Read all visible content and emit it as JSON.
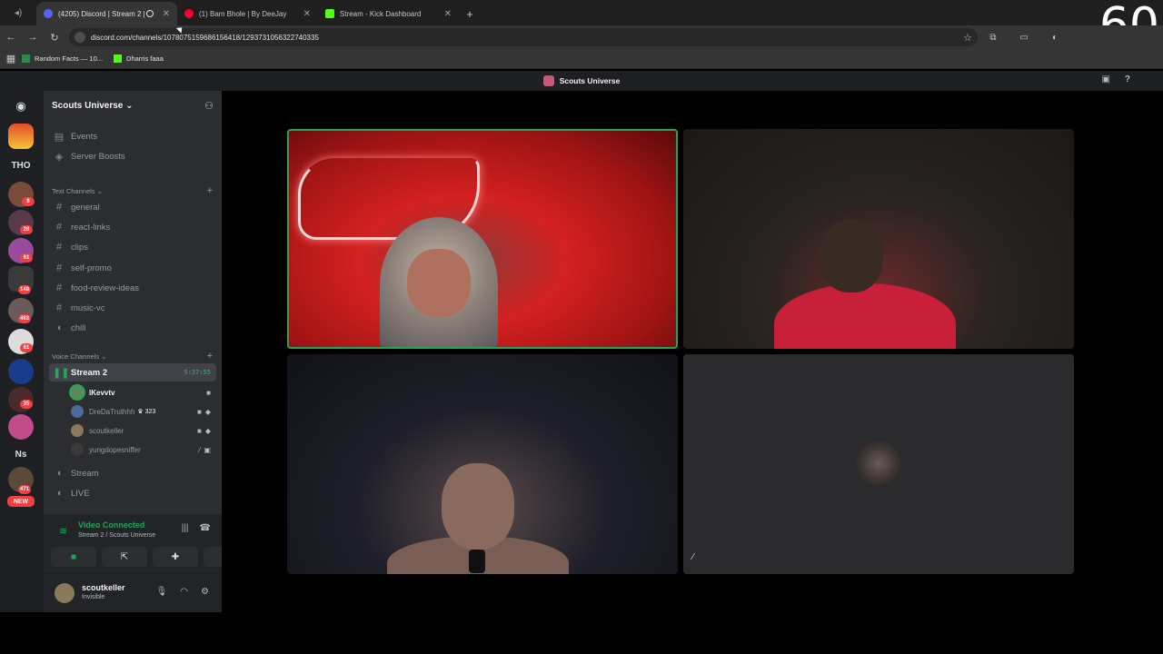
{
  "browser": {
    "tabs": [
      {
        "label": "(4205) Discord | Stream 2 | S",
        "active": true
      },
      {
        "label": "(1) Bam Bhole | By DeeJay",
        "active": false
      },
      {
        "label": "Stream - Kick Dashboard",
        "active": false
      }
    ],
    "url": "discord.com/channels/1078075159686156418/1293731056322740335",
    "bookmarks": [
      "Random Facts — 10...",
      "Dharris faaa"
    ],
    "overlay_counter": "60"
  },
  "discord": {
    "title": "Scouts Universe",
    "rail": {
      "thread_label": "THO",
      "ns_label": "Ns",
      "new_label": "NEW",
      "badges": [
        "8",
        "28",
        "61",
        "148",
        "463",
        "61",
        "35",
        "471"
      ]
    },
    "server_name": "Scouts Universe",
    "top_items": [
      "Events",
      "Server Boosts"
    ],
    "text_category": "Text Channels",
    "text_channels": [
      "general",
      "react-links",
      "clips",
      "self-promo",
      "food-review-ideas",
      "music-vc",
      "chill"
    ],
    "voice_category": "Voice Channels",
    "voice_channel": {
      "name": "Stream 2",
      "timer": "5:37:55"
    },
    "voice_users": [
      {
        "name": "lKevvtv",
        "speaking": true
      },
      {
        "name": "DreDaTruthhh",
        "boost": "323",
        "speaking": false
      },
      {
        "name": "scoutkeller",
        "speaking": false
      },
      {
        "name": "yungdopesniffer",
        "speaking": false
      }
    ],
    "other_voice": [
      "Stream",
      "LIVE"
    ],
    "voice_panel": {
      "status": "Video Connected",
      "location": "Stream 2 / Scouts Universe"
    },
    "user": {
      "name": "scoutkeller",
      "status": "Invisible"
    }
  },
  "colors": {
    "accent_green": "#23a55a",
    "badge_red": "#f23f43"
  }
}
